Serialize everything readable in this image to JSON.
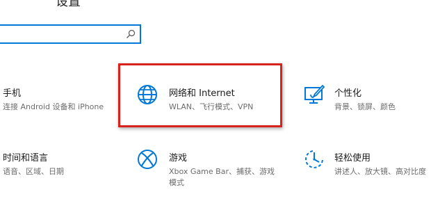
{
  "page": {
    "title": "设置"
  },
  "search": {
    "placeholder": ""
  },
  "tiles": {
    "phone": {
      "name": "手机",
      "desc": "连接 Android 设备和 iPhone"
    },
    "network": {
      "name": "网络和 Internet",
      "desc": "WLAN、飞行模式、VPN"
    },
    "personalization": {
      "name": "个性化",
      "desc": "背景、锁屏、颜色"
    },
    "time_language": {
      "name": "时间和语言",
      "desc": "语音、区域、日期"
    },
    "gaming": {
      "name": "游戏",
      "desc_line1": "Xbox Game Bar、捕获、游戏",
      "desc_line2": "模式"
    },
    "ease_of_access": {
      "name": "轻松使用",
      "desc": "讲述人、放大镜、高对比度"
    }
  },
  "colors": {
    "accent": "#0078d7",
    "highlight_border": "#d9221c"
  }
}
